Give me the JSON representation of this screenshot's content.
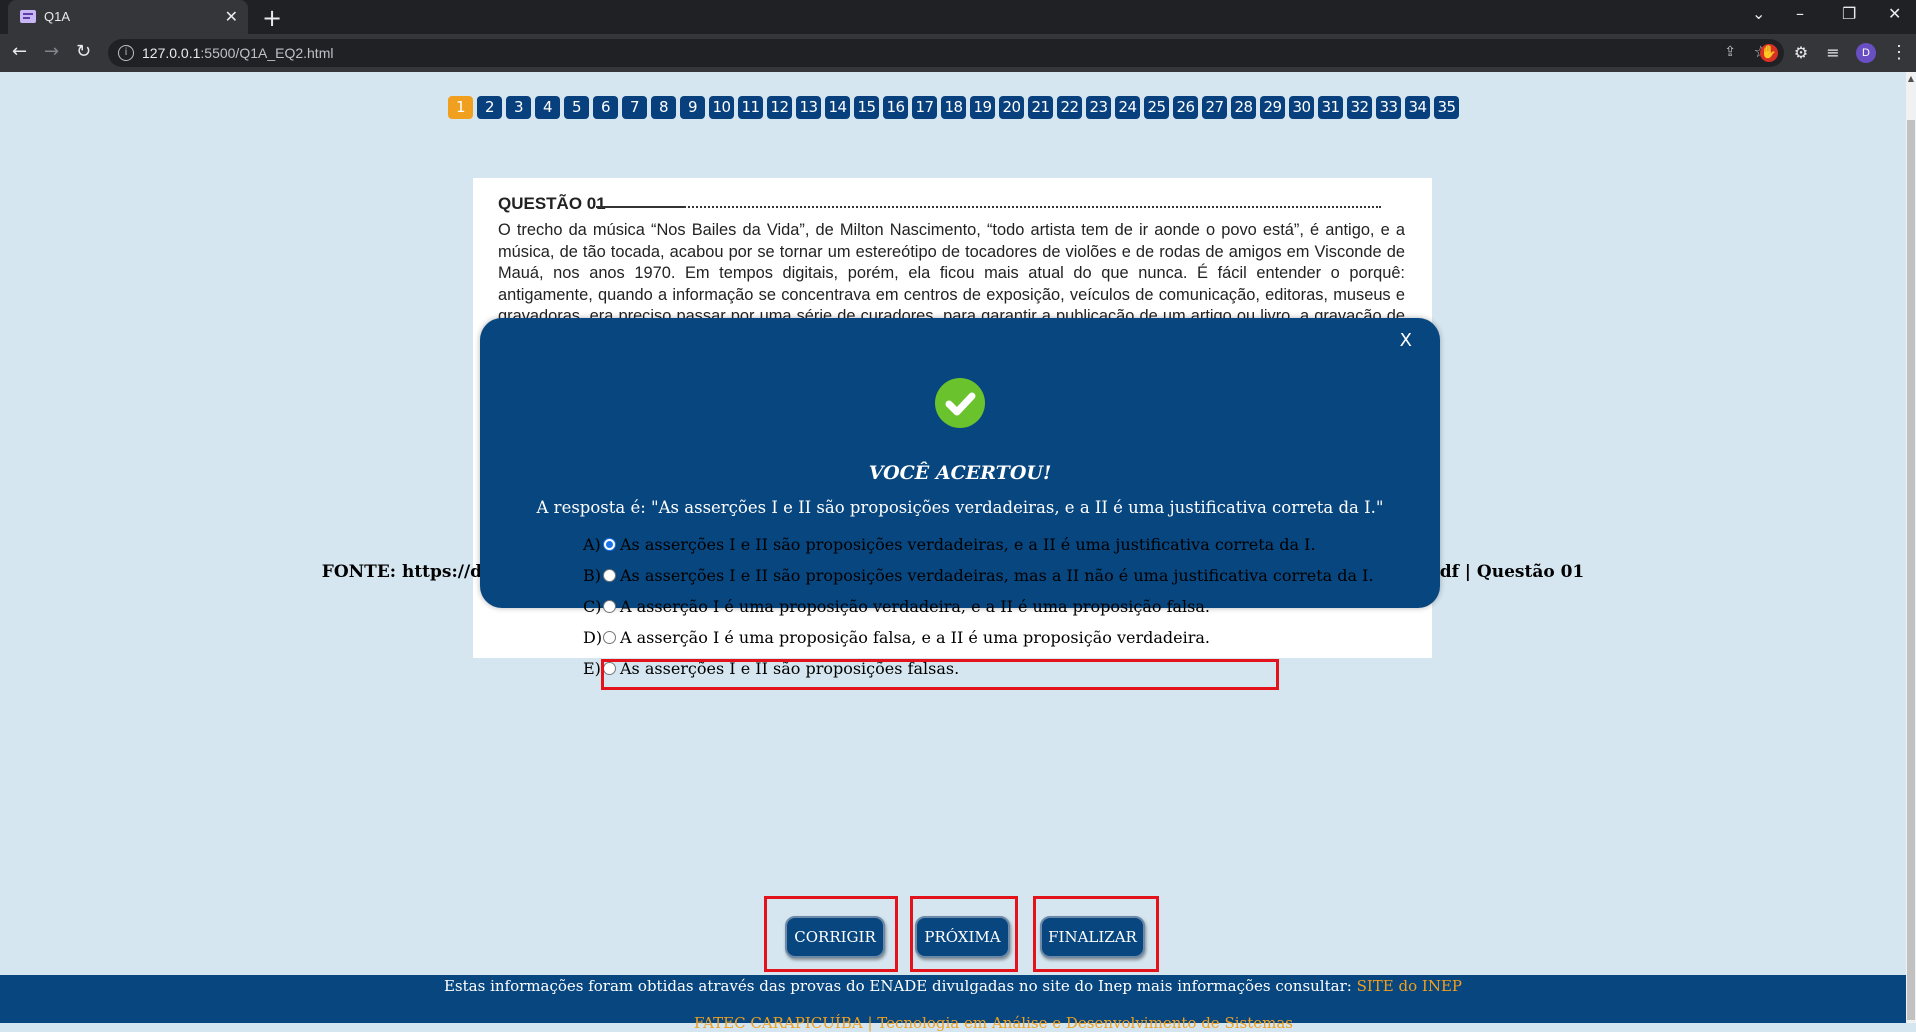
{
  "browser": {
    "tab_title": "Q1A",
    "url_host": "127.0.0.1",
    "url_rest": ":5500/Q1A_EQ2.html",
    "avatar_letter": "D"
  },
  "question_nav": [
    "1",
    "2",
    "3",
    "4",
    "5",
    "6",
    "7",
    "8",
    "9",
    "10",
    "11",
    "12",
    "13",
    "14",
    "15",
    "16",
    "17",
    "18",
    "19",
    "20",
    "21",
    "22",
    "23",
    "24",
    "25",
    "26",
    "27",
    "28",
    "29",
    "30",
    "31",
    "32",
    "33",
    "34",
    "35"
  ],
  "question_nav_active": "1",
  "question": {
    "header": "QUESTÃO 01",
    "body": "O trecho da música “Nos Bailes da Vida”, de Milton Nascimento, “todo artista tem de ir aonde o povo está”, é antigo, e a música, de tão tocada, acabou por se tornar um estereótipo de tocadores de violões e de rodas de amigos em Visconde de Mauá, nos anos 1970. Em tempos digitais, porém, ela ficou mais atual do que nunca. É fácil entender o porquê: antigamente, quando a informação se concentrava em centros de exposição, veículos de comunicação, editoras, museus e gravadoras, era preciso passar por uma série de curadores, para garantir a publicação de um artigo ou livro, a gravação de um disco ou a produção de uma exposição. O mesmo funil, que poderia ser injusto e deixar grandes talentos de fora, simplesmente porque não tinham acesso às ferramentas, às pessoas ou às fontes da informação, também servia como filtro de qualidade. Ter visão ou apenas uma peça de teatro era um grande"
  },
  "modal": {
    "close_label": "X",
    "headline": "VOCÊ ACERTOU!",
    "answer": "A resposta é: \"As asserções I e II são proposições verdadeiras, e a II é uma justificativa correta da I.\""
  },
  "fonte": "FONTE: https://download.inep.gov.br/educacao_superior/enade/provas/2014/40_tecnologia_analise_desenv_sistemas.pdf | Questão 01",
  "options": [
    {
      "letter": "A)",
      "text": "As asserções I e II são proposições verdadeiras, e a II é uma justificativa correta da I.",
      "checked": true
    },
    {
      "letter": "B)",
      "text": "As asserções I e II são proposições verdadeiras, mas a II não é uma justificativa correta da I.",
      "checked": false
    },
    {
      "letter": "C)",
      "text": "A asserção I é uma proposição verdadeira, e a II é uma proposição falsa.",
      "checked": false
    },
    {
      "letter": "D)",
      "text": "A asserção I é uma proposição falsa, e a II é uma proposição verdadeira.",
      "checked": false
    },
    {
      "letter": "E)",
      "text": "As asserções I e II são proposições falsas.",
      "checked": false
    }
  ],
  "buttons": {
    "corrigir": "CORRIGIR",
    "proxima": "PRÓXIMA",
    "finalizar": "FINALIZAR"
  },
  "footer": {
    "text": "Estas informações foram obtidas através das provas do ENADE divulgadas no site do Inep mais informações consultar: ",
    "link": "SITE do INEP",
    "line2": "FATEC CARAPICUÍBA | Tecnologia em Análise e Desenvolvimento de Sistemas"
  },
  "colors": {
    "primary": "#08467f",
    "accent": "#f0a01e",
    "highlight": "#e3121b",
    "success": "#6ac22c"
  }
}
